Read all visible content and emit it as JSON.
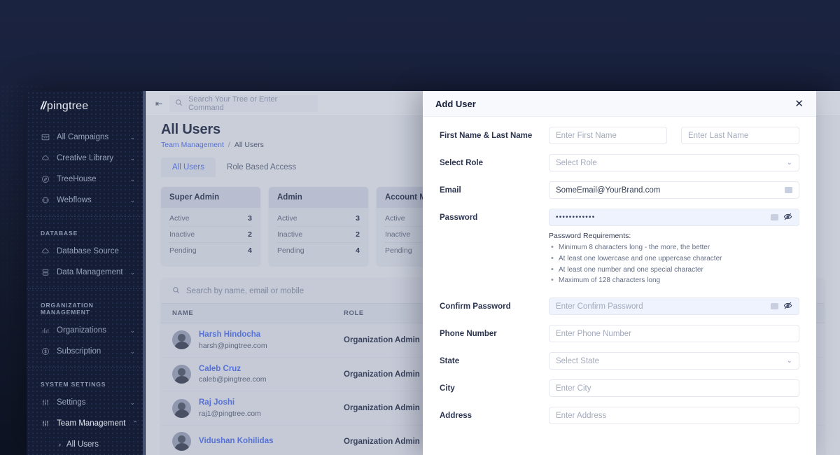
{
  "brand": {
    "slash": "//",
    "name": "pingtree"
  },
  "sidebar": {
    "items": [
      {
        "label": "All Campaigns",
        "icon": "calendar-icon",
        "chevron": "⌄"
      },
      {
        "label": "Creative Library",
        "icon": "cloud-icon",
        "chevron": "⌄"
      },
      {
        "label": "TreeHouse",
        "icon": "compass-icon",
        "chevron": "⌄"
      },
      {
        "label": "Webflows",
        "icon": "webflow-icon",
        "chevron": "⌄"
      }
    ],
    "group_database": "DATABASE",
    "database_items": [
      {
        "label": "Database Source",
        "icon": "cloud-icon",
        "chevron": ""
      },
      {
        "label": "Data Management",
        "icon": "database-icon",
        "chevron": "⌄"
      }
    ],
    "group_organization": "ORGANIZATION MANAGEMENT",
    "organization_items": [
      {
        "label": "Organizations",
        "icon": "building-icon",
        "chevron": "⌄"
      },
      {
        "label": "Subscription",
        "icon": "dollar-circle-icon",
        "chevron": "⌄"
      }
    ],
    "group_system": "SYSTEM SETTINGS",
    "system_items": [
      {
        "label": "Settings",
        "icon": "sliders-icon",
        "chevron": "⌄"
      },
      {
        "label": "Team Management",
        "icon": "sliders-icon",
        "chevron": "⌃"
      }
    ],
    "sub_item": {
      "label": "All Users",
      "arrow": "›"
    }
  },
  "topbar": {
    "collapse_icon": "collapse-panel-icon",
    "search_placeholder": "Search Your Tree or Enter Command"
  },
  "page": {
    "title": "All Users",
    "breadcrumb_parent": "Team Management",
    "breadcrumb_sep": "/",
    "breadcrumb_current": "All Users",
    "tabs": [
      {
        "label": "All Users",
        "active": true
      },
      {
        "label": "Role Based Access",
        "active": false
      }
    ]
  },
  "cards": [
    {
      "title": "Super Admin",
      "rows": [
        {
          "label": "Active",
          "value": "3"
        },
        {
          "label": "Inactive",
          "value": "2"
        },
        {
          "label": "Pending",
          "value": "4"
        }
      ]
    },
    {
      "title": "Admin",
      "rows": [
        {
          "label": "Active",
          "value": "3"
        },
        {
          "label": "Inactive",
          "value": "2"
        },
        {
          "label": "Pending",
          "value": "4"
        }
      ]
    },
    {
      "title": "Account Manager",
      "rows": [
        {
          "label": "Active",
          "value": ""
        },
        {
          "label": "Inactive",
          "value": ""
        },
        {
          "label": "Pending",
          "value": ""
        }
      ]
    }
  ],
  "table": {
    "search_placeholder": "Search by name, email or mobile",
    "columns": {
      "name": "NAME",
      "role": "ROLE"
    },
    "rows": [
      {
        "name": "Harsh Hindocha",
        "email": "harsh@pingtree.com",
        "role": "Organization Admin"
      },
      {
        "name": "Caleb Cruz",
        "email": "caleb@pingtree.com",
        "role": "Organization Admin"
      },
      {
        "name": "Raj Joshi",
        "email": "raj1@pingtree.com",
        "role": "Organization Admin"
      },
      {
        "name": "Vidushan Kohilidas",
        "email": "",
        "role": "Organization Admin"
      }
    ]
  },
  "drawer": {
    "title": "Add User",
    "close_icon": "✕",
    "fields": {
      "name_label": "First Name & Last Name",
      "first_name_placeholder": "Enter First Name",
      "last_name_placeholder": "Enter Last Name",
      "role_label": "Select Role",
      "role_value": "Select Role",
      "email_label": "Email",
      "email_value": "SomeEmail@YourBrand.com",
      "password_label": "Password",
      "password_value": "••••••••••••",
      "confirm_label": "Confirm Password",
      "confirm_placeholder": "Enter Confirm Password",
      "phone_label": "Phone Number",
      "phone_placeholder": "Enter Phone Number",
      "state_label": "State",
      "state_value": "Select State",
      "city_label": "City",
      "city_placeholder": "Enter City",
      "address_label": "Address",
      "address_placeholder": "Enter Address"
    },
    "password_requirements": {
      "title": "Password Requirements:",
      "items": [
        "Minimum 8 characters long - the more, the better",
        "At least one lowercase and one uppercase character",
        "At least one number and one special character",
        "Maximum of 128 characters long"
      ]
    }
  },
  "colors": {
    "brand_blue": "#4a6cf0",
    "dark_navy": "#151d36",
    "panel_bg": "#ffffff",
    "main_bg": "#edeff4"
  }
}
